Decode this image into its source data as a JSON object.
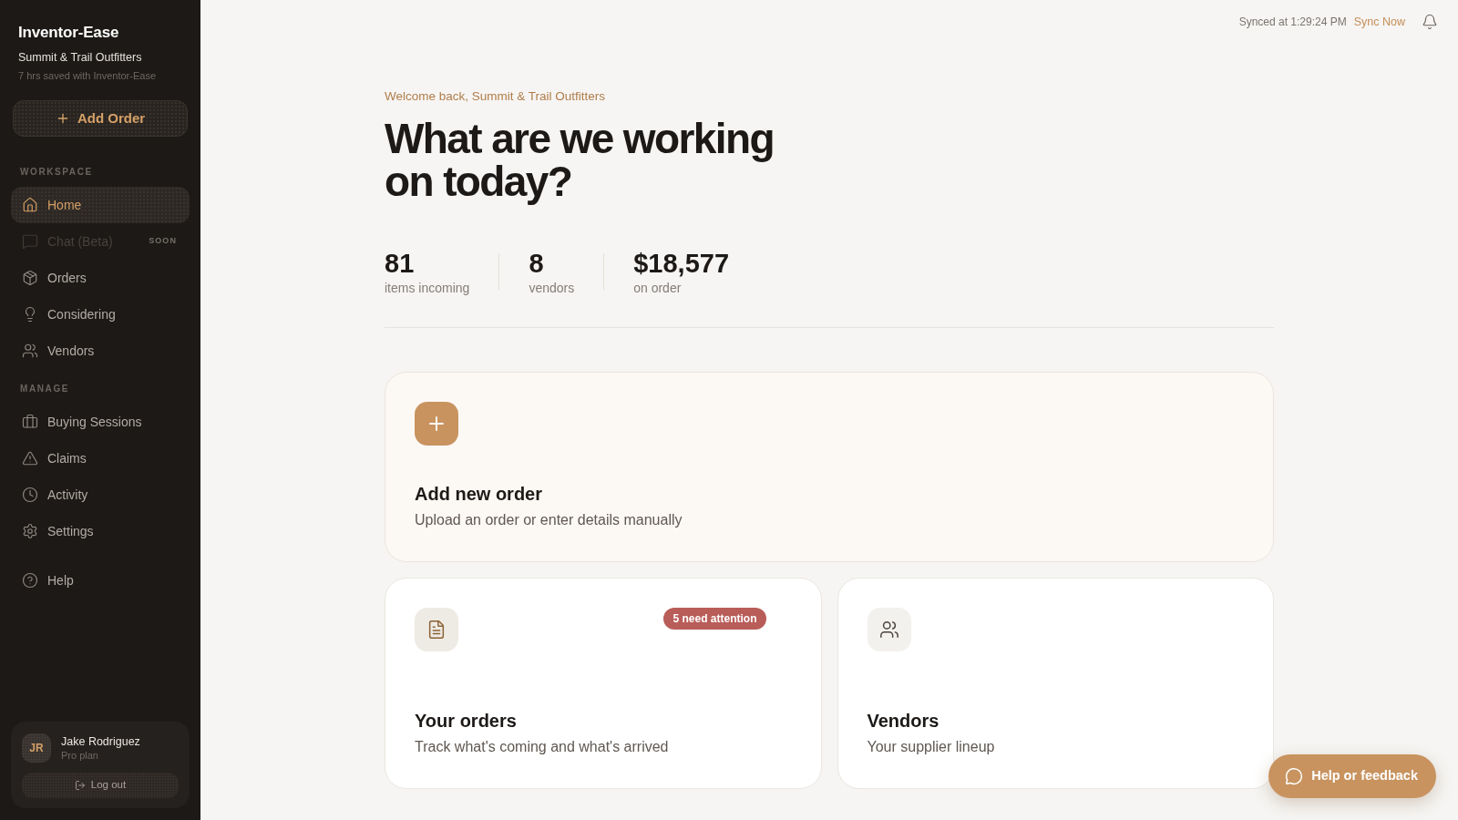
{
  "sidebar": {
    "brand": "Inventor-Ease",
    "company": "Summit & Trail Outfitters",
    "time_saved": "7 hrs saved with Inventor-Ease",
    "add_button": "Add Order",
    "sections": [
      {
        "label": "WORKSPACE",
        "items": [
          {
            "label": "Home",
            "selected": true,
            "disabled": false
          },
          {
            "label": "Chat (Beta)",
            "selected": false,
            "disabled": true,
            "tag": "SOON"
          },
          {
            "label": "Orders",
            "selected": false,
            "disabled": false
          },
          {
            "label": "Considering",
            "selected": false,
            "disabled": false
          },
          {
            "label": "Vendors",
            "selected": false,
            "disabled": false
          }
        ]
      },
      {
        "label": "MANAGE",
        "items": [
          {
            "label": "Buying Sessions",
            "selected": false,
            "disabled": false
          },
          {
            "label": "Claims",
            "selected": false,
            "disabled": false
          },
          {
            "label": "Activity",
            "selected": false,
            "disabled": false
          },
          {
            "label": "Settings",
            "selected": false,
            "disabled": false
          }
        ]
      },
      {
        "items": [
          {
            "label": "Help",
            "selected": false,
            "disabled": false
          }
        ]
      }
    ],
    "user": {
      "initials": "JR",
      "name": "Jake Rodriguez",
      "plan": "Pro plan",
      "logout_button": "Log out"
    }
  },
  "header": {
    "sync_status": "Synced at 1:29:24 PM",
    "sync_action": "Sync Now"
  },
  "greeting": "Welcome back, Summit & Trail Outfitters",
  "heading": "What are we working on today?",
  "stats": [
    {
      "value": "81",
      "label": "items incoming"
    },
    {
      "value": "8",
      "label": "vendors"
    },
    {
      "value": "$18,577",
      "label": "on order"
    }
  ],
  "cards": [
    {
      "kind": "primary",
      "title": "Add new order",
      "description": "Upload an order or enter details manually"
    },
    {
      "kind": "secondary",
      "title": "Your orders",
      "description": "Track what's coming and what's arrived",
      "badge": "5 need attention"
    },
    {
      "kind": "secondary",
      "title": "Vendors",
      "description": "Your supplier lineup"
    }
  ],
  "help_button": "Help or feedback"
}
